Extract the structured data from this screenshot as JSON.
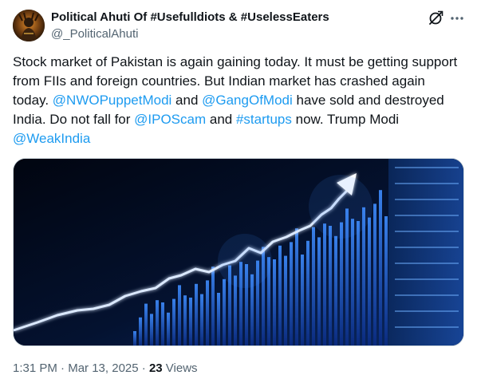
{
  "author": {
    "display_name": "Political Ahuti Of #Usefulldiots & #UselessEaters",
    "handle": "@_PoliticalAhuti",
    "avatar_icon": "avatar-figure-icon"
  },
  "header_actions": {
    "grok_icon": "grok-icon",
    "more_icon": "more-dots-icon"
  },
  "tweet": {
    "segments": {
      "t1": "Stock market of Pakistan is again gaining today. It must be getting support from FIIs and foreign countries. But Indian market has crashed again today. ",
      "m1": "@NWOPuppetModi",
      "t2": " and ",
      "m2": "@GangOfModi",
      "t3": " have sold and destroyed India. Do not fall for ",
      "m3": "@IPOScam",
      "t4": " and ",
      "h1": "#startups",
      "t5": " now. Trump Modi ",
      "m4": "@WeakIndia"
    }
  },
  "meta": {
    "time": "1:31 PM",
    "sep1": " · ",
    "date": "Mar 13, 2025",
    "sep2": " · ",
    "views_count": "23",
    "views_label": " Views"
  },
  "colors": {
    "link": "#1d9bf0",
    "text": "#0f1419",
    "secondary": "#536471",
    "media_bg": "#020814",
    "glow": "#2f7bff"
  }
}
